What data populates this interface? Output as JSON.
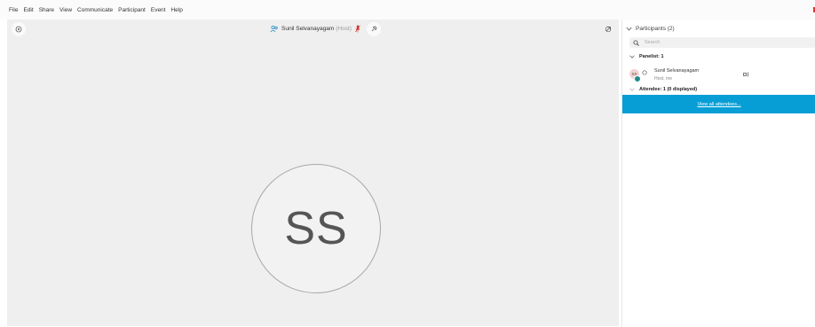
{
  "menu": [
    "File",
    "Edit",
    "Share",
    "View",
    "Communicate",
    "Participant",
    "Event",
    "Help"
  ],
  "stage": {
    "speaker_name": "Sunil Selvanayagam",
    "speaker_role": "(Host)",
    "avatar_initials": "SS"
  },
  "participants": {
    "header": "Participants (2)",
    "search_placeholder": "Search",
    "panelists_label": "Panelist: 1",
    "row": {
      "initials": "SS",
      "name": "Sunil Selvanayagam",
      "role": "Host, me"
    },
    "attendees_label": "Attendee: 1 (0 displayed)",
    "view_all": "View all attendees..."
  },
  "colors": {
    "accent": "#079ed6",
    "stage_bg": "#efefef",
    "mic_muted": "#d33333",
    "presence": "#1f8a8a"
  }
}
